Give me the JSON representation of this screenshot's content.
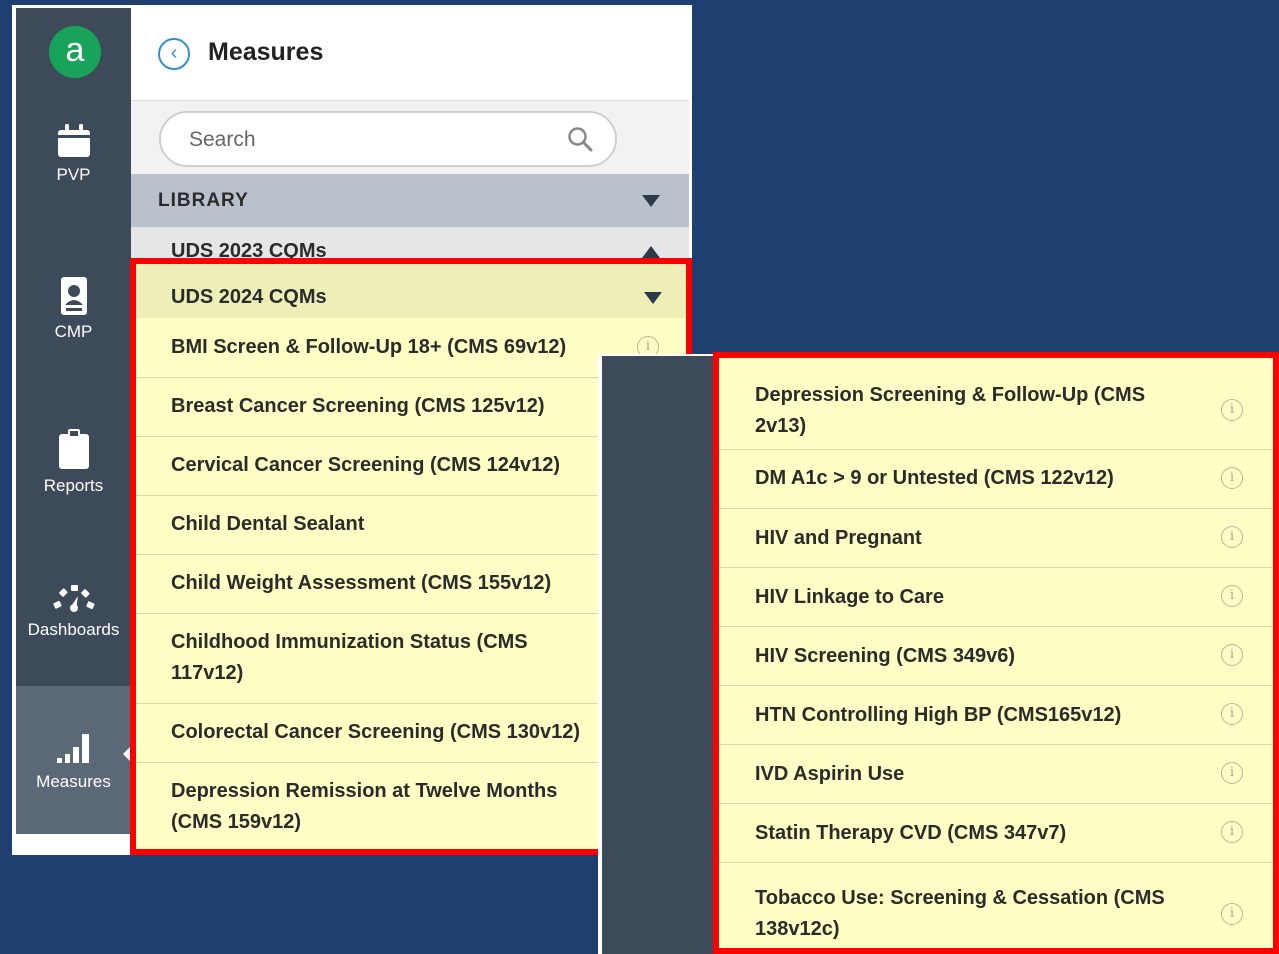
{
  "app": {
    "logo_letter": "a"
  },
  "sidebar": {
    "items": [
      {
        "label": "PVP",
        "icon": "calendar-icon"
      },
      {
        "label": "CMP",
        "icon": "patient-card-icon"
      },
      {
        "label": "Reports",
        "icon": "clipboard-icon"
      },
      {
        "label": "Dashboards",
        "icon": "gauge-icon"
      },
      {
        "label": "Measures",
        "icon": "bar-chart-icon"
      }
    ],
    "active": "Measures"
  },
  "panel": {
    "title": "Measures",
    "search_placeholder": "Search",
    "library_label": "LIBRARY",
    "group_2023": "UDS 2023 CQMs",
    "group_2024": "UDS 2024 CQMs"
  },
  "measures_left": [
    {
      "line1": "BMI Screen & Follow-Up 18+ (CMS 69v12)",
      "line2": ""
    },
    {
      "line1": "Breast Cancer Screening (CMS 125v12)",
      "line2": ""
    },
    {
      "line1": "Cervical Cancer Screening (CMS 124v12)",
      "line2": ""
    },
    {
      "line1": "Child Dental Sealant",
      "line2": ""
    },
    {
      "line1": "Child Weight Assessment (CMS 155v12)",
      "line2": ""
    },
    {
      "line1": "Childhood Immunization Status (CMS",
      "line2": "117v12)"
    },
    {
      "line1": "Colorectal Cancer Screening (CMS 130v12)",
      "line2": ""
    },
    {
      "line1": "Depression Remission at Twelve Months",
      "line2": "(CMS 159v12)"
    }
  ],
  "measures_right": [
    {
      "line1": "Depression Screening & Follow-Up (CMS",
      "line2": "2v13)"
    },
    {
      "line1": "DM A1c > 9 or Untested (CMS 122v12)",
      "line2": ""
    },
    {
      "line1": "HIV and Pregnant",
      "line2": ""
    },
    {
      "line1": "HIV Linkage to Care",
      "line2": ""
    },
    {
      "line1": "HIV Screening (CMS 349v6)",
      "line2": ""
    },
    {
      "line1": "HTN Controlling High BP (CMS165v12)",
      "line2": ""
    },
    {
      "line1": "IVD Aspirin Use",
      "line2": ""
    },
    {
      "line1": "Statin Therapy CVD (CMS 347v7)",
      "line2": ""
    },
    {
      "line1": "Tobacco Use: Screening & Cessation (CMS",
      "line2": "138v12c)"
    }
  ],
  "info_glyph": "i",
  "colors": {
    "background": "#1e3f6f",
    "sidebar": "#3d4a5a",
    "highlight_border": "#ff0000",
    "row_background": "#fffec4",
    "logo": "#18a35b",
    "back_button": "#2f8fd8"
  }
}
